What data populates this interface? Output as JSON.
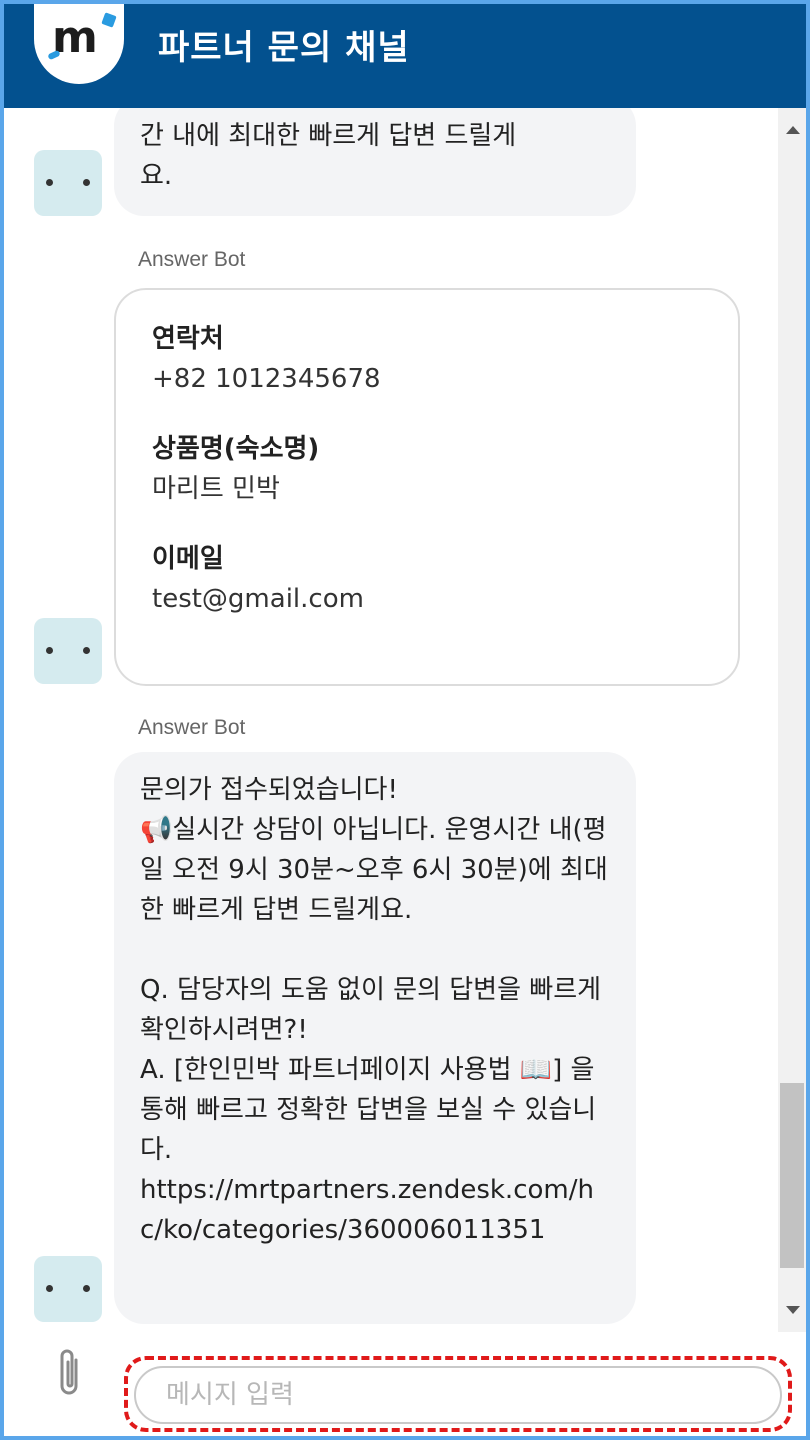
{
  "header": {
    "logo_text": "m",
    "title": "파트너 문의 채널"
  },
  "messages": {
    "m1": {
      "text": "간 내에 최대한 빠르게 답변 드릴게\n요."
    },
    "m2": {
      "sender": "Answer Bot",
      "fields": [
        {
          "label": "연락처",
          "value": "+82 1012345678"
        },
        {
          "label": "상품명(숙소명)",
          "value": "마리트 민박"
        },
        {
          "label": "이메일",
          "value": "test@gmail.com"
        }
      ]
    },
    "m3": {
      "sender": "Answer Bot",
      "text": "문의가 접수되었습니다!\n📢실시간 상담이 아닙니다. 운영시간 내(평일 오전 9시 30분~오후 6시 30분)에 최대한 빠르게 답변 드릴게요.\n\nQ. 담당자의 도움 없이 문의 답변을 빠르게 확인하시려면?!\nA. [한인민박 파트너페이지 사용법 📖] 을 통해 빠르고 정확한 답변을 보실 수 있습니다.\nhttps://mrtpartners.zendesk.com/hc/ko/categories/360006011351"
    }
  },
  "composer": {
    "placeholder": "메시지 입력",
    "value": ""
  },
  "icons": {
    "avatar": "bot-avatar-icon",
    "attach": "paperclip-icon"
  },
  "colors": {
    "header_bg": "#03518f",
    "frame_border": "#5aa6ea",
    "highlight": "#e01a1a",
    "bubble_bg": "#f3f4f6",
    "avatar_bg": "#d5ebef"
  }
}
